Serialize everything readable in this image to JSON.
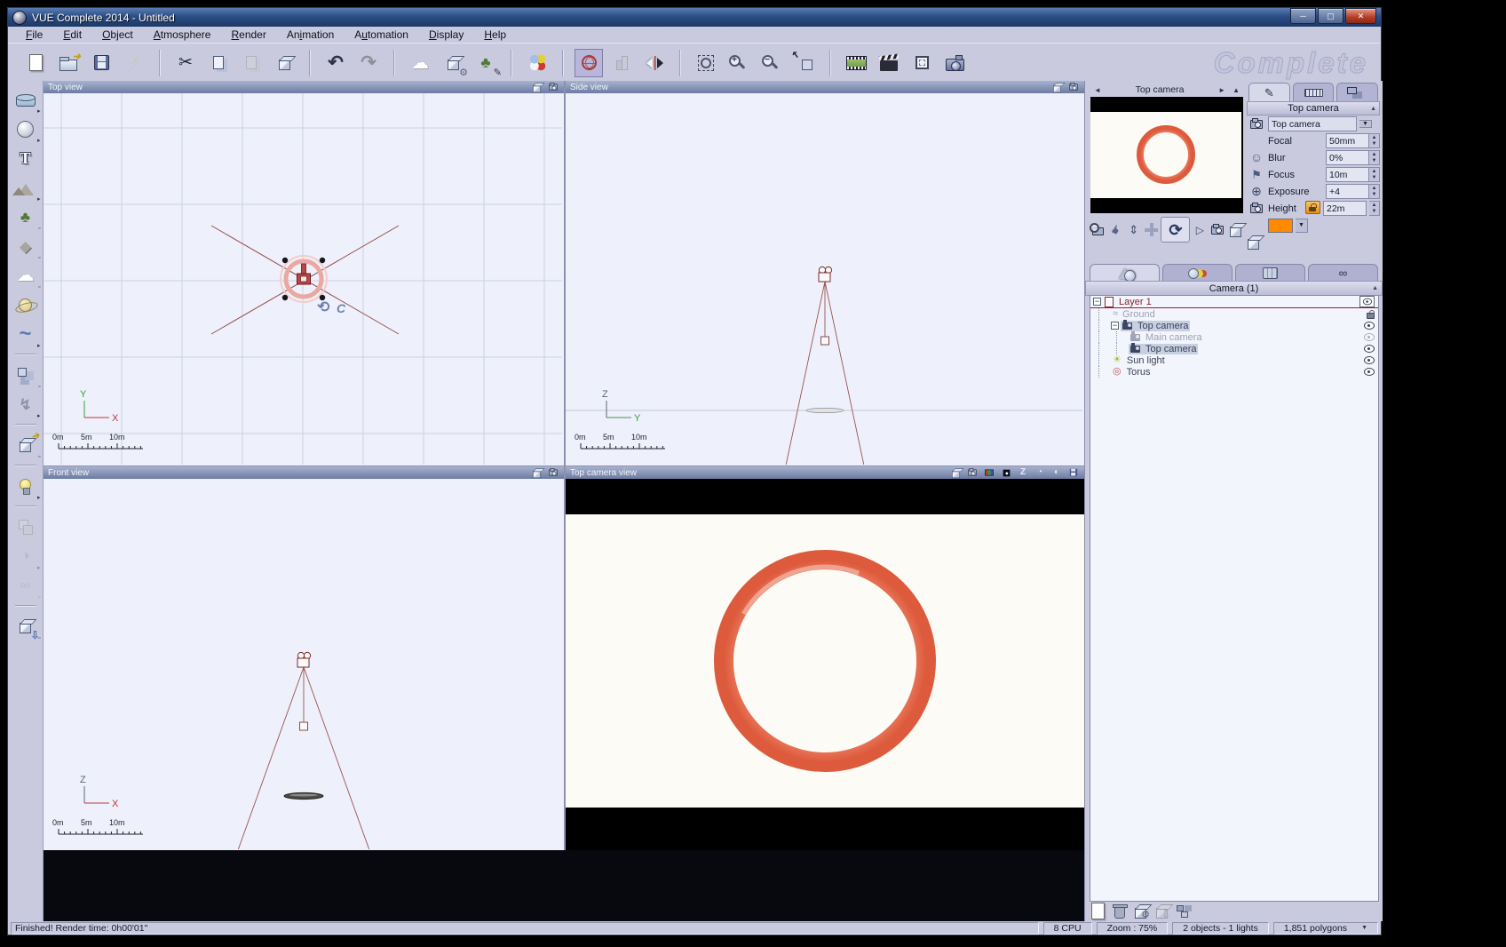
{
  "window": {
    "title": "VUE Complete 2014 - Untitled",
    "watermark": "Complete",
    "controls": [
      {
        "name": "minimize-button",
        "glyph": "─"
      },
      {
        "name": "maximize-button",
        "glyph": "▢"
      },
      {
        "name": "close-button",
        "glyph": "✕"
      }
    ]
  },
  "menu": {
    "items": [
      {
        "label": "File",
        "u": 0
      },
      {
        "label": "Edit",
        "u": 0
      },
      {
        "label": "Object",
        "u": 0
      },
      {
        "label": "Atmosphere",
        "u": 0
      },
      {
        "label": "Render",
        "u": 0
      },
      {
        "label": "Animation",
        "u": 2
      },
      {
        "label": "Automation",
        "u": 1
      },
      {
        "label": "Display",
        "u": 0
      },
      {
        "label": "Help",
        "u": 0
      }
    ]
  },
  "toolbar": {
    "groups": [
      {
        "icons": [
          {
            "name": "new-scene-icon",
            "k": "page"
          },
          {
            "name": "open-scene-icon",
            "k": "folder"
          },
          {
            "name": "save-scene-icon",
            "k": "floppy"
          },
          {
            "name": "quick-render-save-icon",
            "k": "flash",
            "disabled": true
          }
        ]
      },
      {
        "icons": [
          {
            "name": "cut-icon",
            "k": "cut"
          },
          {
            "name": "copy-icon",
            "k": "copy"
          },
          {
            "name": "paste-icon",
            "k": "paste",
            "disabled": true
          },
          {
            "name": "paste-object-icon",
            "k": "cube"
          }
        ]
      },
      {
        "icons": [
          {
            "name": "undo-icon",
            "k": "undo"
          },
          {
            "name": "redo-icon",
            "k": "redo",
            "disabled": true
          }
        ]
      },
      {
        "icons": [
          {
            "name": "atmosphere-editor-icon",
            "k": "cloud"
          },
          {
            "name": "scene-options-icon",
            "k": "cubegear"
          },
          {
            "name": "plant-editor-icon",
            "k": "treebrush"
          }
        ]
      },
      {
        "icons": [
          {
            "name": "material-editor-icon",
            "k": "materials"
          }
        ]
      },
      {
        "icons": [
          {
            "name": "world-browser-icon",
            "k": "globe",
            "active": true
          },
          {
            "name": "statistics-icon",
            "k": "bars",
            "disabled": true
          },
          {
            "name": "mirror-object-icon",
            "k": "flip"
          }
        ]
      },
      {
        "icons": [
          {
            "name": "zoom-region-icon",
            "k": "zoomregion"
          },
          {
            "name": "zoom-in-icon",
            "k": "zoomin"
          },
          {
            "name": "zoom-out-icon",
            "k": "zoomout"
          },
          {
            "name": "fit-view-icon",
            "k": "fit"
          }
        ]
      },
      {
        "icons": [
          {
            "name": "render-animation-icon",
            "k": "film"
          },
          {
            "name": "animation-wizard-icon",
            "k": "clapper"
          },
          {
            "name": "render-area-icon",
            "k": "frame"
          },
          {
            "name": "render-scene-icon",
            "k": "camera"
          }
        ]
      }
    ]
  },
  "left_toolbar": {
    "items": [
      {
        "name": "water-plane-tool",
        "k": "water",
        "mk": "arrow"
      },
      {
        "name": "sphere-tool",
        "k": "sphere",
        "mk": "arrow"
      },
      {
        "name": "text-tool",
        "k": "text"
      },
      {
        "name": "terrain-tool",
        "k": "terrain",
        "mk": "arrow"
      },
      {
        "name": "plant-tool",
        "k": "tree",
        "mk": "sq"
      },
      {
        "name": "rock-tool",
        "k": "rock",
        "mk": "sq"
      },
      {
        "name": "cloud-tool",
        "k": "cloud",
        "mk": "sq"
      },
      {
        "name": "planet-tool",
        "k": "planet"
      },
      {
        "name": "curve-tool",
        "k": "curve",
        "mk": "arrow"
      },
      {
        "sep": true
      },
      {
        "name": "scatter-tool",
        "k": "scatter",
        "mk": "sq"
      },
      {
        "name": "wind-tool",
        "k": "wind",
        "mk": "arrow"
      },
      {
        "sep": true
      },
      {
        "name": "import-object-tool",
        "k": "exportcube",
        "mk": "sq"
      },
      {
        "sep": true
      },
      {
        "name": "light-tool",
        "k": "bulb",
        "mk": "arrow"
      },
      {
        "sep": true
      },
      {
        "name": "group-tool",
        "k": "group",
        "disabled": true
      },
      {
        "name": "boolean-tool",
        "k": "boolean",
        "disabled": true,
        "mk": "arrow"
      },
      {
        "name": "metaball-tool",
        "k": "metaball",
        "disabled": true,
        "mk": "sq"
      },
      {
        "sep": true
      },
      {
        "name": "drop-object-tool",
        "k": "drop",
        "mk": "sq"
      }
    ]
  },
  "viewports": {
    "top": {
      "title": "Top view",
      "axis_v": "Y",
      "axis_h": "X",
      "ruler": [
        "0m",
        "5m",
        "10m"
      ],
      "icons": [
        {
          "name": "display-options-icon",
          "k": "cube"
        },
        {
          "name": "view-camera-icon",
          "k": "ccam"
        }
      ]
    },
    "side": {
      "title": "Side view",
      "axis_v": "Z",
      "axis_h": "Y",
      "ruler": [
        "0m",
        "5m",
        "10m"
      ],
      "icons": [
        {
          "name": "display-options-icon",
          "k": "cube"
        },
        {
          "name": "view-camera-icon",
          "k": "ccam"
        }
      ]
    },
    "front": {
      "title": "Front view",
      "axis_v": "Z",
      "axis_h": "X",
      "ruler": [
        "0m",
        "5m",
        "10m"
      ],
      "icons": [
        {
          "name": "display-options-icon",
          "k": "cube"
        },
        {
          "name": "view-camera-icon",
          "k": "ccam"
        }
      ]
    },
    "camera": {
      "title": "Top camera view",
      "icons": [
        {
          "name": "display-options-icon",
          "k": "cube"
        },
        {
          "name": "view-camera-icon",
          "k": "ccam"
        },
        {
          "name": "rgb-display-icon",
          "k": "rgb"
        },
        {
          "name": "mask-display-icon",
          "k": "dotsq"
        },
        {
          "name": "z-buffer-icon",
          "k": "zletter"
        },
        {
          "name": "render-timer-icon",
          "k": "timer"
        },
        {
          "name": "contrast-icon",
          "k": "contrast"
        },
        {
          "name": "save-render-icon",
          "k": "floppysm"
        }
      ]
    }
  },
  "preview": {
    "title": "Top camera",
    "buttons": [
      {
        "name": "preview-zoom-icon",
        "k": "magcam"
      },
      {
        "name": "pan-view-icon",
        "k": "hand"
      },
      {
        "name": "move-updown-icon",
        "k": "updown"
      },
      {
        "name": "move-dpad-icon",
        "k": "dpad"
      },
      {
        "name": "rotate-view-icon",
        "k": "rotate",
        "active": true
      },
      {
        "name": "aim-camera-icon",
        "k": "play"
      },
      {
        "name": "camera-small-icon",
        "k": "ccam"
      },
      {
        "name": "display-cube-icon",
        "k": "cube"
      }
    ]
  },
  "properties": {
    "tabs": [
      {
        "name": "tab-aspect",
        "k": "pencil",
        "active": true
      },
      {
        "name": "tab-numerics",
        "k": "rulert"
      },
      {
        "name": "tab-camera-links",
        "k": "links"
      }
    ],
    "header": "Top camera",
    "camera_select": "Top camera",
    "rows": [
      {
        "icon": "camera-lock-icon",
        "k": "ccam",
        "type": "select"
      },
      {
        "label": "Focal",
        "value": "50mm"
      },
      {
        "icon": "motion-blur-icon",
        "k": "face",
        "label": "Blur",
        "value": "0%"
      },
      {
        "icon": "postcard-icon",
        "k": "flag",
        "label": "Focus",
        "value": "10m"
      },
      {
        "icon": "target-icon",
        "k": "target",
        "label": "Exposure",
        "value": "+4"
      },
      {
        "icon": "camera-settings-icon",
        "k": "ccam",
        "label": "Height",
        "value": "22m",
        "locked": true
      }
    ],
    "accent_color": "#ff8a00"
  },
  "layers": {
    "tabs": [
      {
        "name": "tab-objects",
        "k": "objects",
        "active": true
      },
      {
        "name": "tab-materials",
        "k": "mats3"
      },
      {
        "name": "tab-library",
        "k": "lib"
      },
      {
        "name": "tab-links",
        "k": "chain"
      }
    ],
    "header": "Camera (1)",
    "tree": [
      {
        "label": "Layer 1",
        "level": 0,
        "type": "layer",
        "expand": true,
        "right": "eyebox"
      },
      {
        "label": "Ground",
        "level": 1,
        "type": "ground",
        "disabled": true,
        "right": "lock"
      },
      {
        "label": "Top camera",
        "level": 1,
        "type": "camera",
        "expand": true,
        "selected": true,
        "right": "eye"
      },
      {
        "label": "Main camera",
        "level": 2,
        "type": "camera",
        "disabled": true,
        "right": "eyedim"
      },
      {
        "label": "Top camera",
        "level": 2,
        "type": "camera",
        "selected": true,
        "right": "eye"
      },
      {
        "label": "Sun light",
        "level": 1,
        "type": "sun",
        "right": "eye"
      },
      {
        "label": "Torus",
        "level": 1,
        "type": "torus",
        "right": "eye"
      }
    ],
    "bottom_icons": [
      {
        "name": "new-layer-icon",
        "k": "page"
      },
      {
        "name": "delete-object-icon",
        "k": "trash"
      },
      {
        "name": "edit-object-icon",
        "k": "cubegear"
      },
      {
        "name": "drop-object-icon",
        "k": "drop",
        "disabled": true
      },
      {
        "name": "hierarchy-icon",
        "k": "hier"
      }
    ]
  },
  "statusbar": {
    "message": "Finished! Render time: 0h00'01\"",
    "segments": [
      "8 CPU",
      "Zoom : 75%",
      "2 objects - 1 lights",
      "1,851 polygons"
    ]
  }
}
